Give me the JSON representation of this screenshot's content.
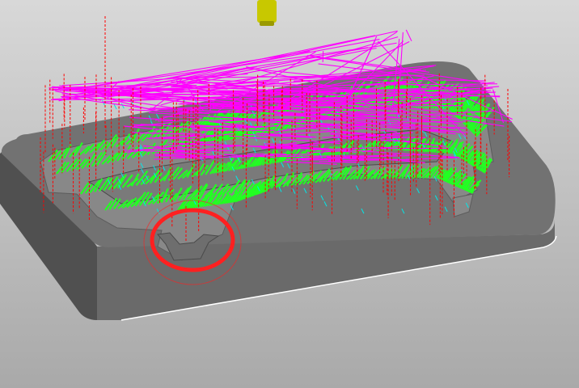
{
  "viewport": {
    "background_top": "#d8d8d8",
    "background_bottom": "#a9a9a9"
  },
  "part": {
    "top_color": "#727272",
    "side_color": "#505050",
    "front_color": "#6a6a6a",
    "pocket_color": "#888888",
    "edge_color": "#ffffff"
  },
  "tool": {
    "icon": "end-mill-tool-icon",
    "color": "#c8c800"
  },
  "toolpaths": {
    "feed_color": "#22ff22",
    "rapid_color": "#ff00ff",
    "plunge_color": "#ff0000",
    "lead_color": "#00e8e8"
  },
  "highlight": {
    "icon": "highlight-circle-icon",
    "color": "#ff2020"
  }
}
